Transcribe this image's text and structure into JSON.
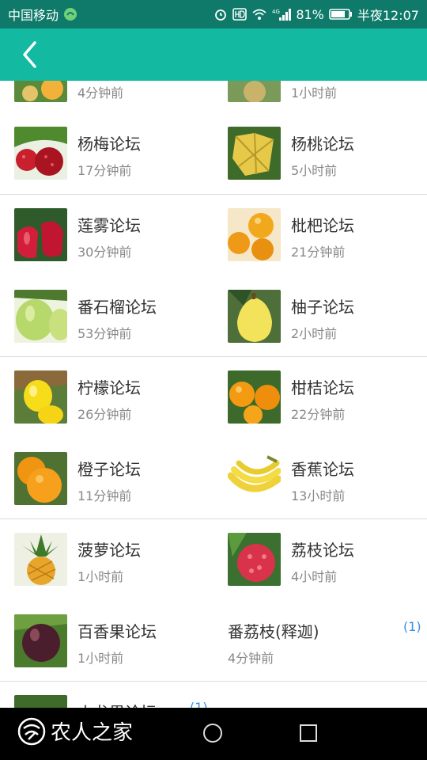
{
  "status_bar": {
    "carrier": "中国移动",
    "battery_percent": "81%",
    "time": "半夜12:07",
    "network": "4G",
    "icons": [
      "carrier-badge-icon",
      "alarm-icon",
      "hd-icon",
      "wifi-icon",
      "signal-icon",
      "battery-icon"
    ]
  },
  "app_bar": {
    "back_icon": "chevron-left-icon"
  },
  "forums": [
    {
      "title": "",
      "time": "4分钟前",
      "image": "fruit-thumbnail",
      "count": ""
    },
    {
      "title": "",
      "time": "1小时前",
      "image": "fruit-thumbnail",
      "count": ""
    },
    {
      "title": "杨梅论坛",
      "time": "17分钟前",
      "image": "bayberry",
      "count": ""
    },
    {
      "title": "杨桃论坛",
      "time": "5小时前",
      "image": "starfruit",
      "count": ""
    },
    {
      "title": "莲雾论坛",
      "time": "30分钟前",
      "image": "wax-apple",
      "count": ""
    },
    {
      "title": "枇杷论坛",
      "time": "21分钟前",
      "image": "loquat",
      "count": ""
    },
    {
      "title": "番石榴论坛",
      "time": "53分钟前",
      "image": "guava",
      "count": ""
    },
    {
      "title": "柚子论坛",
      "time": "2小时前",
      "image": "pomelo",
      "count": ""
    },
    {
      "title": "柠檬论坛",
      "time": "26分钟前",
      "image": "lemon",
      "count": ""
    },
    {
      "title": "柑桔论坛",
      "time": "22分钟前",
      "image": "tangerine",
      "count": ""
    },
    {
      "title": "橙子论坛",
      "time": "11分钟前",
      "image": "orange",
      "count": ""
    },
    {
      "title": "香蕉论坛",
      "time": "13小时前",
      "image": "banana",
      "count": ""
    },
    {
      "title": "菠萝论坛",
      "time": "1小时前",
      "image": "pineapple",
      "count": ""
    },
    {
      "title": "荔枝论坛",
      "time": "4小时前",
      "image": "lychee",
      "count": ""
    },
    {
      "title": "百香果论坛",
      "time": "1小时前",
      "image": "passion-fruit",
      "count": ""
    },
    {
      "title": "番荔枝(释迦)",
      "time": "4分钟前",
      "image": "",
      "count": "(1)"
    },
    {
      "title": "火龙果论坛",
      "time": "",
      "image": "dragon-fruit",
      "count": "(1)"
    }
  ],
  "watermark": {
    "text": "农人之家"
  },
  "colors": {
    "accent": "#14b9a1",
    "status_bar": "#0f7a6a",
    "count": "#3a8ee6"
  }
}
